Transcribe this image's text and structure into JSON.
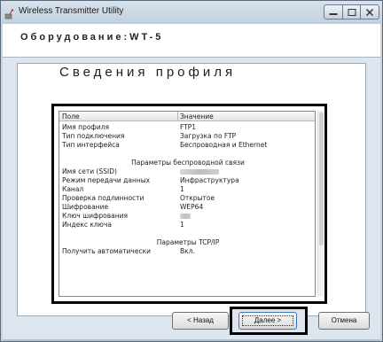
{
  "window": {
    "title": "Wireless Transmitter Utility",
    "icons": {
      "app": "wireless-antenna-icon",
      "minimize": "minimize-icon",
      "maximize": "maximize-icon",
      "close": "close-icon"
    }
  },
  "header": {
    "equipment_title": "Оборудование:WT-5"
  },
  "page": {
    "title": "Сведения профиля"
  },
  "table": {
    "columns": [
      "Поле",
      "Значение"
    ],
    "rows": [
      {
        "key": "Имя профиля",
        "value": "FTP1"
      },
      {
        "key": "Тип подключения",
        "value": "Загрузка по FTP"
      },
      {
        "key": "Тип интерфейса",
        "value": "Беспроводная и Ethernet"
      },
      {
        "section": ""
      },
      {
        "section": "Параметры беспроводной связи"
      },
      {
        "key": "Имя сети (SSID)",
        "value": "",
        "obscured": true
      },
      {
        "key": "Режим передачи данных",
        "value": "Инфраструктура"
      },
      {
        "key": "Канал",
        "value": "1"
      },
      {
        "key": "Проверка подлинности",
        "value": "Открытое"
      },
      {
        "key": "Шифрование",
        "value": "WEP64"
      },
      {
        "key": "Ключ шифрования",
        "value": "",
        "obscured": true
      },
      {
        "key": "Индекс ключа",
        "value": "1"
      },
      {
        "section": ""
      },
      {
        "section": "Параметры TCP/IP"
      },
      {
        "key": "Получить автоматически",
        "value": "Вкл."
      }
    ]
  },
  "buttons": {
    "back": "< Назад",
    "next": "Далее >",
    "cancel": "Отмена"
  },
  "colors": {
    "window_bg": "#c9d4df",
    "highlight_frame": "#000000"
  }
}
